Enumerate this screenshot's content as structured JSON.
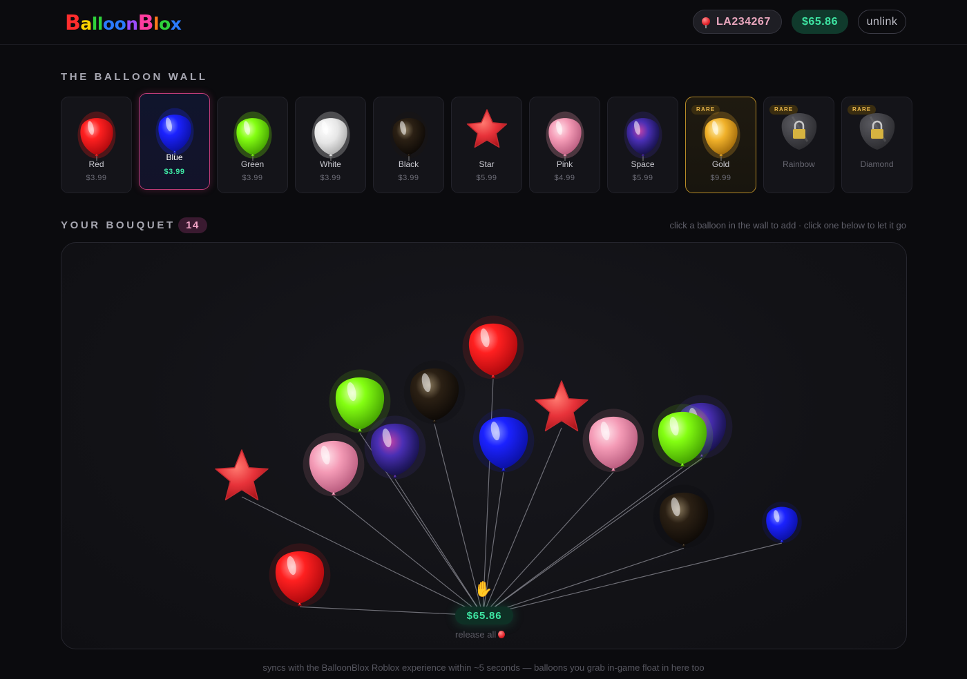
{
  "header": {
    "logo_letters": [
      "B",
      "a",
      "l",
      "l",
      "o",
      "o",
      "n",
      "B",
      "l",
      "o",
      "x"
    ],
    "logo_colors": [
      "#ff2d2d",
      "#ffd400",
      "#2fd13b",
      "#2fd13b",
      "#2b7bff",
      "#2b7bff",
      "#9b4dff",
      "#ff3da0",
      "#ff7a1a",
      "#2fd13b",
      "#2b7bff"
    ],
    "username": "LA234267",
    "balance": "$65.86",
    "unlink_label": "unlink"
  },
  "wall": {
    "title": "THE BALLOON WALL",
    "items": [
      {
        "name": "Red",
        "price": "$3.99",
        "color": "#ff1a1a",
        "shape": "balloon"
      },
      {
        "name": "Blue",
        "price": "$3.99",
        "color": "#1a2bff",
        "shape": "balloon",
        "selected": true
      },
      {
        "name": "Green",
        "price": "$3.99",
        "color": "#7dff0a",
        "shape": "balloon"
      },
      {
        "name": "White",
        "price": "$3.99",
        "color": "#f2f2f2",
        "shape": "balloon"
      },
      {
        "name": "Black",
        "price": "$3.99",
        "color": "#1a1410",
        "shape": "balloon"
      },
      {
        "name": "Star",
        "price": "$5.99",
        "color": "#e8333a",
        "shape": "star"
      },
      {
        "name": "Pink",
        "price": "$4.99",
        "color": "#f29ab5",
        "shape": "balloon"
      },
      {
        "name": "Space",
        "price": "$5.99",
        "color": "#3a2a9a",
        "shape": "space"
      },
      {
        "name": "Gold",
        "price": "$9.99",
        "color": "#e8a92a",
        "shape": "balloon",
        "rare": "RARE"
      },
      {
        "name": "Rainbow",
        "price": "",
        "color": "#444448",
        "shape": "locked",
        "rare": "RARE"
      },
      {
        "name": "Diamond",
        "price": "",
        "color": "#444448",
        "shape": "locked",
        "rare": "RARE"
      }
    ]
  },
  "bouquet": {
    "title": "YOUR BOUQUET",
    "count": "14",
    "hint": "click a balloon in the wall to add · click one below to let it go",
    "total": "$65.86",
    "release_label": "release all"
  },
  "footer": {
    "text": "syncs with the BalloonBlox Roblox experience within ~5 seconds — balloons you grab in-game float in here too"
  }
}
